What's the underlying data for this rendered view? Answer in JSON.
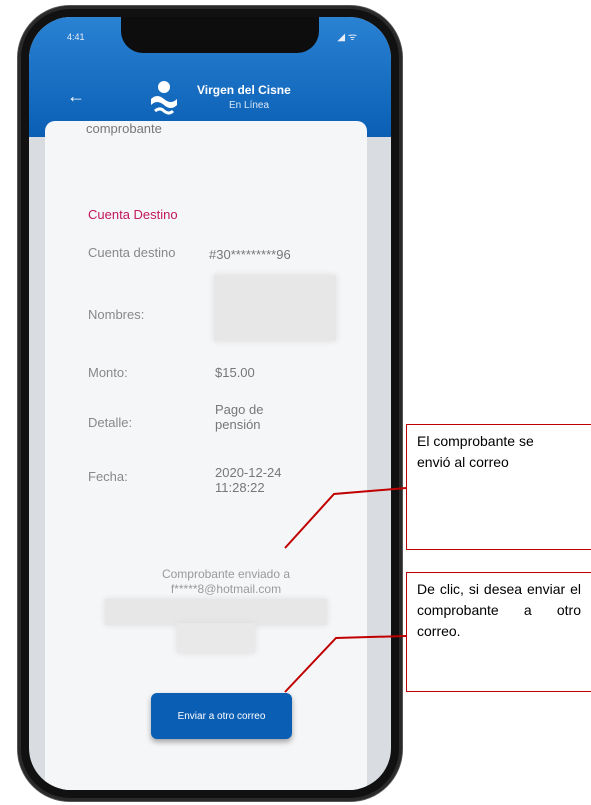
{
  "status_bar": {
    "time": "4:41",
    "icons": "◢ ᯤ"
  },
  "app_bar": {
    "back_icon": "arrow-left-icon",
    "title": "Virgen del Cisne",
    "subtitle": "En Línea"
  },
  "content": {
    "partial_label": "comprobante",
    "section_title": "Cuenta Destino",
    "fields": [
      {
        "label": "Cuenta destino",
        "value": "#30*********96"
      },
      {
        "label": "Nombres:",
        "value": ""
      },
      {
        "label": "Monto:",
        "value": "$15.00"
      },
      {
        "label": "Detalle:",
        "value": "Pago de pensión"
      },
      {
        "label": "Fecha:",
        "value": "2020-12-24 11:28:22"
      }
    ],
    "sent_line1": "Comprobante enviado a",
    "sent_line2": "f*****8@hotmail.com",
    "resend_button": "Enviar a otro correo"
  },
  "annotations": {
    "sent_note": "El comprobante se envió al correo",
    "resend_note": "De clic, si desea enviar el comprobante a otro correo."
  },
  "colors": {
    "primary": "#0a5fb4",
    "accent": "#c2185b",
    "annotation_border": "#c00000"
  }
}
